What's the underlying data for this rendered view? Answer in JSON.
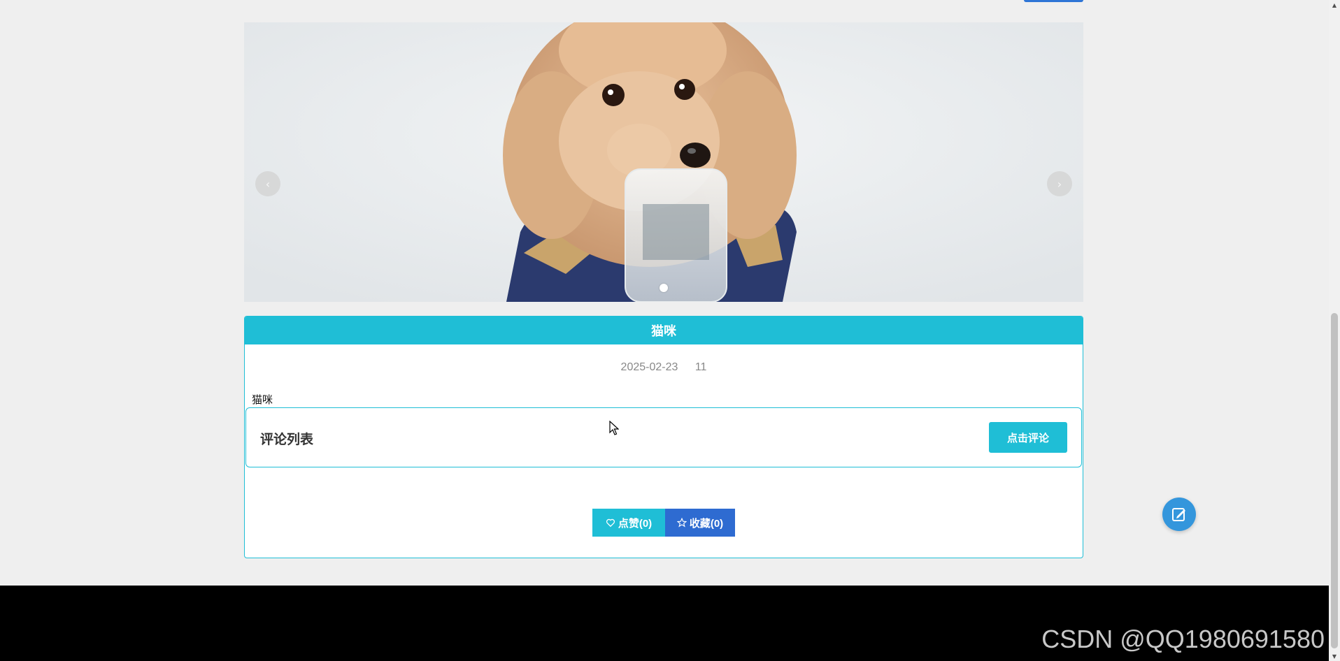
{
  "carousel": {
    "image": "poodle-dog-photo",
    "prev_icon": "chevron-left-icon",
    "next_icon": "chevron-right-icon",
    "slide_count": 1,
    "active_slide": 1
  },
  "post": {
    "title": "猫咪",
    "date": "2025-02-23",
    "views": "11",
    "content": "猫咪"
  },
  "comments": {
    "title": "评论列表",
    "button_label": "点击评论"
  },
  "actions": {
    "like_label": "点赞(0)",
    "favorite_label": "收藏(0)",
    "like_icon": "heart-icon",
    "favorite_icon": "star-icon"
  },
  "fab": {
    "icon": "edit-icon"
  },
  "footer": {
    "watermark": "CSDN @QQ1980691580"
  },
  "colors": {
    "accent": "#1fbed6",
    "favorite": "#2e6bd1",
    "fab": "#3496dc",
    "footer": "#000000",
    "background": "#efefef"
  }
}
